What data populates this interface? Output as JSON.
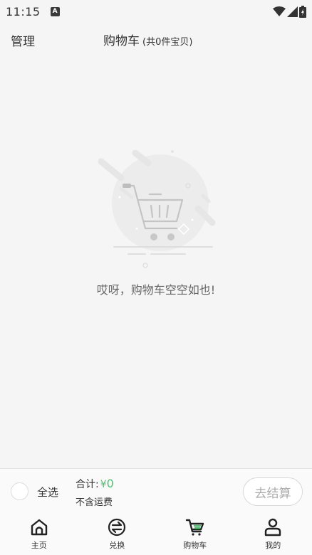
{
  "status_bar": {
    "time": "11:15",
    "notification_icon": "A"
  },
  "header": {
    "manage_label": "管理",
    "title": "购物车",
    "count_text": "(共0件宝贝)"
  },
  "empty_state": {
    "icon": "empty-cart-illustration",
    "message": "哎呀，购物车空空如也!"
  },
  "checkout_bar": {
    "select_all_label": "全选",
    "total_label": "合计:",
    "currency": "¥",
    "total_amount": "0",
    "shipping_note": "不含运费",
    "checkout_label": "去结算"
  },
  "tabs": [
    {
      "label": "主页",
      "icon": "home-icon"
    },
    {
      "label": "兑换",
      "icon": "exchange-icon"
    },
    {
      "label": "购物车",
      "icon": "cart-icon",
      "active": true
    },
    {
      "label": "我的",
      "icon": "profile-icon"
    }
  ],
  "colors": {
    "background": "#f5f5f5",
    "accent_green": "#4cc26c",
    "text": "#333333",
    "muted": "#aaaaaa"
  }
}
